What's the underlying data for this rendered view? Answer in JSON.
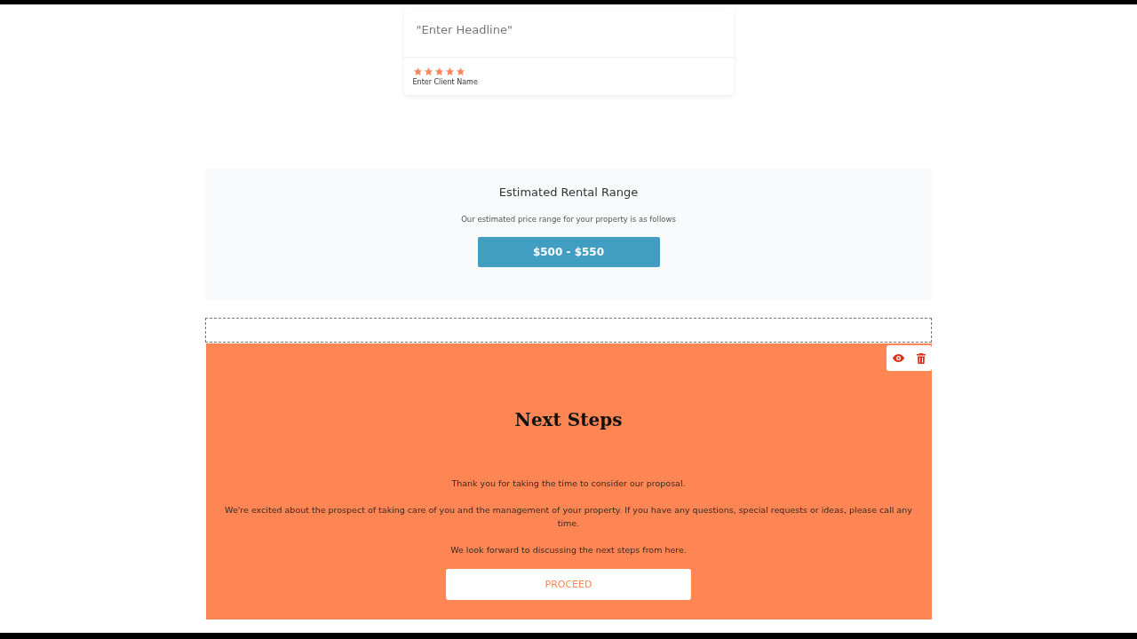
{
  "testimonial": {
    "headline": "\"Enter Headline\"",
    "stars": 5,
    "client_name": "Enter Client Name"
  },
  "pricing": {
    "title": "Estimated Rental Range",
    "subtitle": "Our estimated price range for your property is as follows",
    "price": "$500 - $550"
  },
  "next_steps": {
    "title": "Next Steps",
    "paragraphs": [
      "Thank you for taking the time to consider our proposal.",
      "We're excited about the prospect of taking care of you and the management of your property. If you have any questions, special requests or ideas, please call any time.",
      "We look forward to discussing the next steps from here."
    ],
    "button": "PROCEED"
  }
}
